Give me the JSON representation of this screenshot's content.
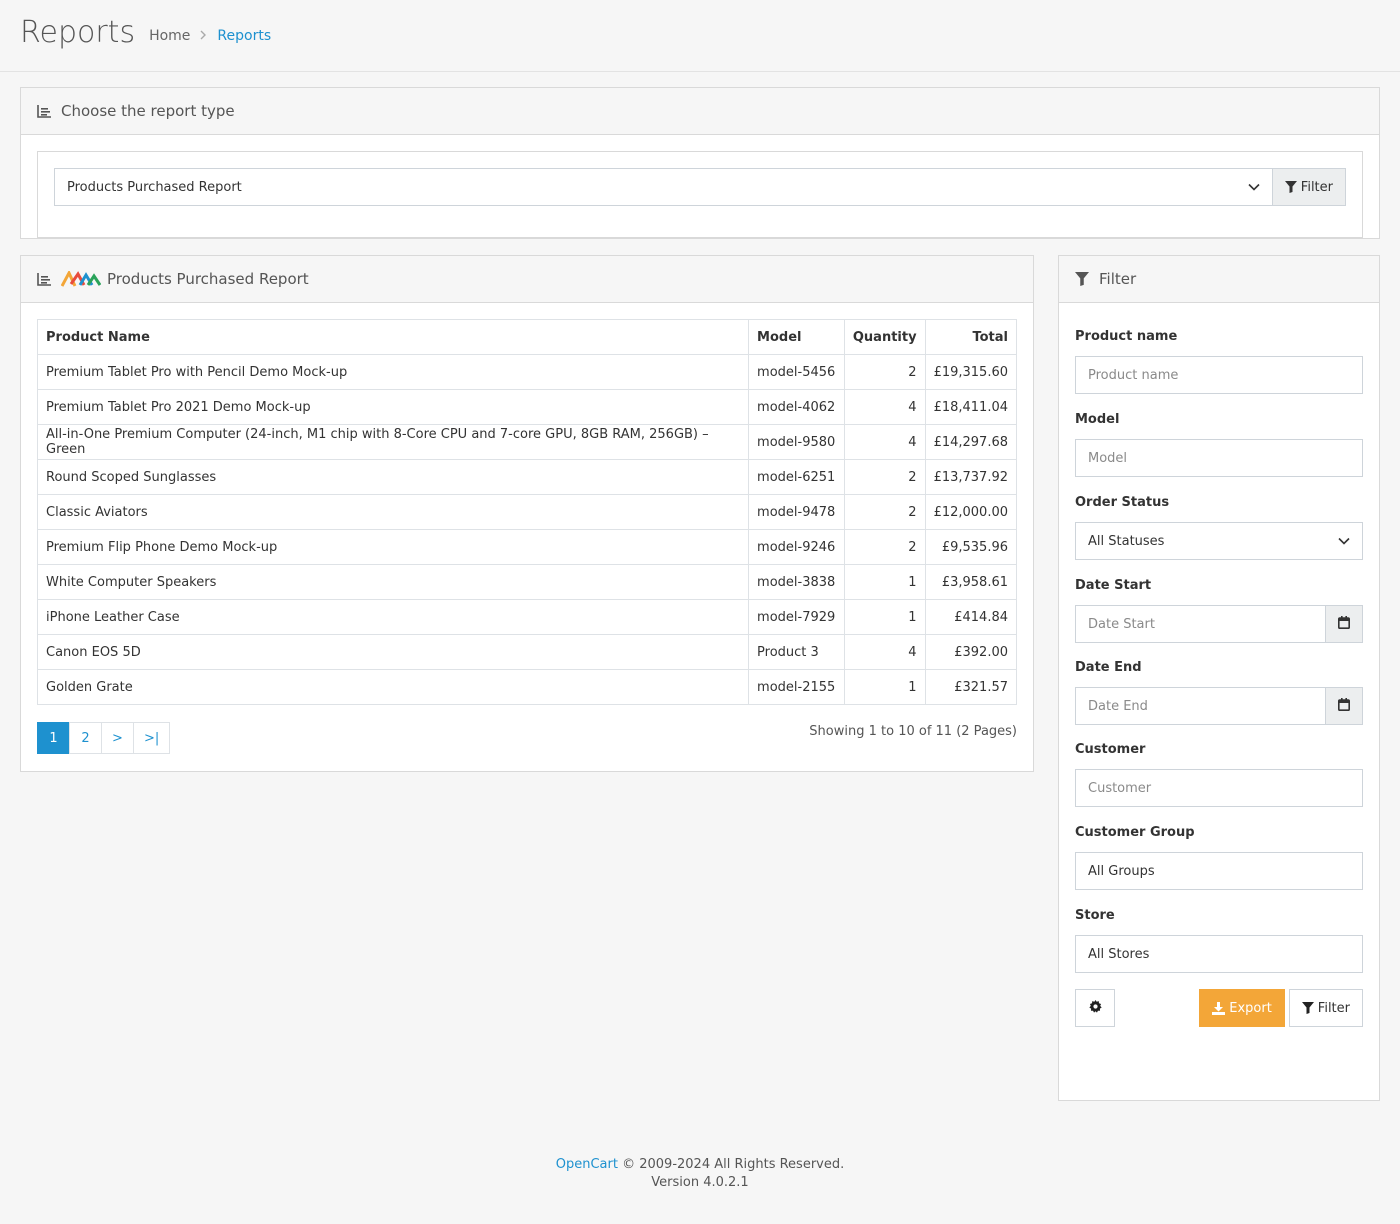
{
  "header": {
    "title": "Reports",
    "breadcrumb": {
      "home": "Home",
      "current": "Reports"
    }
  },
  "report_type": {
    "heading": "Choose the report type",
    "selected": "Products Purchased Report",
    "filter_label": "Filter"
  },
  "report": {
    "heading": "Products Purchased Report",
    "columns": {
      "product": "Product Name",
      "model": "Model",
      "quantity": "Quantity",
      "total": "Total"
    },
    "rows": [
      {
        "product": "Premium Tablet Pro with Pencil Demo Mock-up",
        "model": "model-5456",
        "quantity": "2",
        "total": "£19,315.60"
      },
      {
        "product": "Premium Tablet Pro 2021 Demo Mock-up",
        "model": "model-4062",
        "quantity": "4",
        "total": "£18,411.04"
      },
      {
        "product": "All-in-One Premium Computer (24-inch, M1 chip with 8‑Core CPU and 7‑core GPU, 8GB RAM, 256GB) – Green",
        "model": "model-9580",
        "quantity": "4",
        "total": "£14,297.68"
      },
      {
        "product": "Round Scoped Sunglasses",
        "model": "model-6251",
        "quantity": "2",
        "total": "£13,737.92"
      },
      {
        "product": "Classic Aviators",
        "model": "model-9478",
        "quantity": "2",
        "total": "£12,000.00"
      },
      {
        "product": "Premium Flip Phone Demo Mock-up",
        "model": "model-9246",
        "quantity": "2",
        "total": "£9,535.96"
      },
      {
        "product": "White Computer Speakers",
        "model": "model-3838",
        "quantity": "1",
        "total": "£3,958.61"
      },
      {
        "product": "iPhone Leather Case",
        "model": "model-7929",
        "quantity": "1",
        "total": "£414.84"
      },
      {
        "product": "Canon EOS 5D",
        "model": "Product 3",
        "quantity": "4",
        "total": "£392.00"
      },
      {
        "product": "Golden Grate",
        "model": "model-2155",
        "quantity": "1",
        "total": "£321.57"
      }
    ],
    "pagination": [
      "1",
      "2",
      ">",
      ">|"
    ],
    "results": "Showing 1 to 10 of 11 (2 Pages)"
  },
  "filter": {
    "heading": "Filter",
    "product_name": {
      "label": "Product name",
      "placeholder": "Product name"
    },
    "model": {
      "label": "Model",
      "placeholder": "Model"
    },
    "order_status": {
      "label": "Order Status",
      "value": "All Statuses"
    },
    "date_start": {
      "label": "Date Start",
      "placeholder": "Date Start"
    },
    "date_end": {
      "label": "Date End",
      "placeholder": "Date End"
    },
    "customer": {
      "label": "Customer",
      "placeholder": "Customer"
    },
    "customer_group": {
      "label": "Customer Group",
      "value": "All Groups"
    },
    "store": {
      "label": "Store",
      "value": "All Stores"
    },
    "export_label": "Export",
    "filter_label": "Filter"
  },
  "footer": {
    "brand": "OpenCart",
    "copyright": " © 2009-2024 All Rights Reserved.",
    "version": "Version 4.0.2.1"
  },
  "colors": {
    "accent": "#1e91cf",
    "warning": "#f3a638"
  }
}
